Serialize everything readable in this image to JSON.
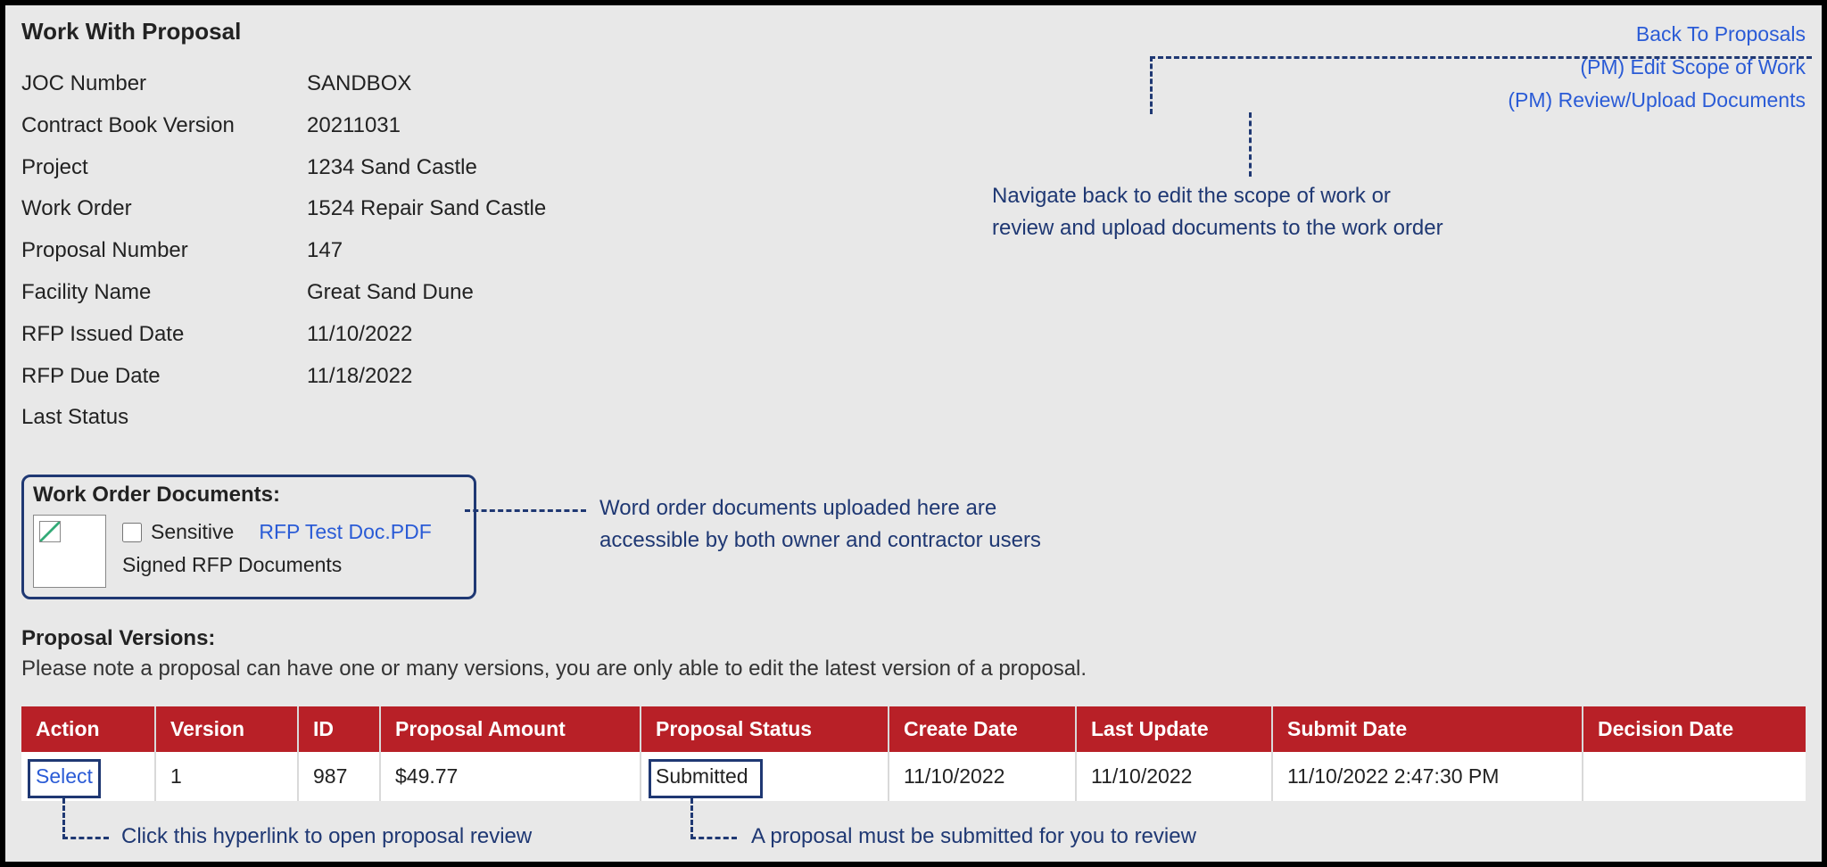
{
  "page_title": "Work With Proposal",
  "nav": {
    "back": "Back To Proposals",
    "edit_scope": "(PM) Edit Scope of Work",
    "review_upload": "(PM) Review/Upload Documents"
  },
  "annotations": {
    "nav_note": "Navigate back to edit the scope of work or\nreview and upload documents to the work order",
    "docs_note": "Word order documents uploaded here are\naccessible by both owner and contractor users",
    "select_note": "Click this hyperlink to open proposal review",
    "submitted_note": "A proposal must be submitted for you to review"
  },
  "info": {
    "joc_label": "JOC Number",
    "joc_value": "SANDBOX",
    "book_label": "Contract Book Version",
    "book_value": "20211031",
    "project_label": "Project",
    "project_value": "1234  Sand Castle",
    "wo_label": "Work Order",
    "wo_value": "1524  Repair Sand Castle",
    "propnum_label": "Proposal Number",
    "propnum_value": "147",
    "facility_label": "Facility Name",
    "facility_value": "Great Sand Dune",
    "rfp_issued_label": "RFP Issued Date",
    "rfp_issued_value": "11/10/2022",
    "rfp_due_label": "RFP Due Date",
    "rfp_due_value": "11/18/2022",
    "last_status_label": "Last Status",
    "last_status_value": ""
  },
  "docs": {
    "title": "Work Order Documents:",
    "sensitive_label": "Sensitive",
    "doc_link_text": "RFP Test Doc.PDF",
    "doc_type": "Signed RFP Documents"
  },
  "versions": {
    "title": "Proposal Versions:",
    "note": "Please note a proposal can have one or many versions, you are only able to edit the latest version of a proposal.",
    "headers": {
      "action": "Action",
      "version": "Version",
      "id": "ID",
      "amount": "Proposal Amount",
      "status": "Proposal Status",
      "create": "Create Date",
      "lastu": "Last Update",
      "submit": "Submit Date",
      "decision": "Decision Date"
    },
    "rows": [
      {
        "action_text": "Select",
        "version": "1",
        "id": "987",
        "amount": "$49.77",
        "status": "Submitted",
        "create": "11/10/2022",
        "lastu": "11/10/2022",
        "submit": "11/10/2022 2:47:30 PM",
        "decision": ""
      }
    ]
  }
}
